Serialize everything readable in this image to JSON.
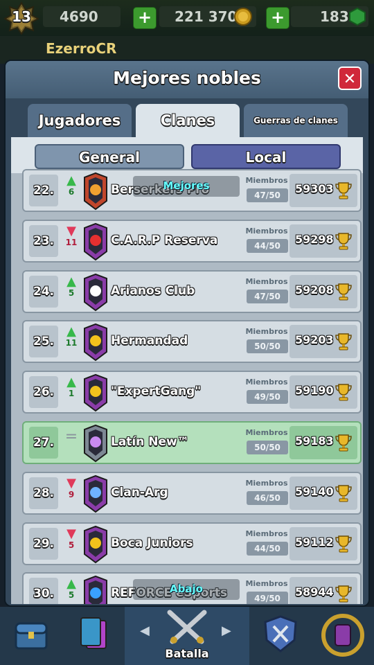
{
  "player": {
    "level": "13",
    "name": "EzerroCR"
  },
  "resources": {
    "trophies": "4690",
    "gold": "221 370",
    "gems": "183"
  },
  "modal": {
    "title": "Mejores nobles",
    "tabs": [
      "Jugadores",
      "Clanes",
      "Guerras de clanes"
    ],
    "active_tab": "Clanes",
    "segments": [
      "General",
      "Local"
    ],
    "active_segment": "Local"
  },
  "members_label": "Miembros",
  "overlay": {
    "top": "Mejores",
    "bottom": "Abajo"
  },
  "rows": [
    {
      "rank": "22.",
      "trend": "up",
      "change": "6",
      "name": "Berserkers Pro",
      "members": "47/50",
      "trophies": "59303",
      "badge_color": "#c0462c",
      "emblem": "#f0a030"
    },
    {
      "rank": "23.",
      "trend": "down",
      "change": "11",
      "name": "C.A.R.P Reserva",
      "members": "44/50",
      "trophies": "59298",
      "badge_color": "#8a3ca8",
      "emblem": "#e63030"
    },
    {
      "rank": "24.",
      "trend": "up",
      "change": "5",
      "name": "Arianos Club",
      "members": "47/50",
      "trophies": "59208",
      "badge_color": "#8a3ca8",
      "emblem": "#ffffff"
    },
    {
      "rank": "25.",
      "trend": "up",
      "change": "11",
      "name": "Hermandad",
      "members": "50/50",
      "trophies": "59203",
      "badge_color": "#8a3ca8",
      "emblem": "#f2c21c"
    },
    {
      "rank": "26.",
      "trend": "up",
      "change": "1",
      "name": "\"ExpertGang\"",
      "members": "49/50",
      "trophies": "59190",
      "badge_color": "#8a3ca8",
      "emblem": "#f2c21c"
    },
    {
      "rank": "27.",
      "trend": "same",
      "change": "",
      "name": "Latín New™",
      "members": "50/50",
      "trophies": "59183",
      "badge_color": "#7d8894",
      "emblem": "#c98af0",
      "highlight": true
    },
    {
      "rank": "28.",
      "trend": "down",
      "change": "9",
      "name": "Clan-Arg",
      "members": "46/50",
      "trophies": "59140",
      "badge_color": "#8a3ca8",
      "emblem": "#6fb2ff"
    },
    {
      "rank": "29.",
      "trend": "down",
      "change": "5",
      "name": "Boca Juniors",
      "members": "44/50",
      "trophies": "59112",
      "badge_color": "#8a3ca8",
      "emblem": "#f2c21c"
    },
    {
      "rank": "30.",
      "trend": "up",
      "change": "5",
      "name": "REFORCE eSports",
      "members": "49/50",
      "trophies": "58944",
      "badge_color": "#8a3ca8",
      "emblem": "#3aa0ff"
    }
  ],
  "nav": {
    "label": "Batalla"
  },
  "colors": {
    "accent_up": "#37b84a",
    "accent_down": "#e0395a",
    "close_red": "#d0283a",
    "segment_active": "#5a64a6"
  }
}
